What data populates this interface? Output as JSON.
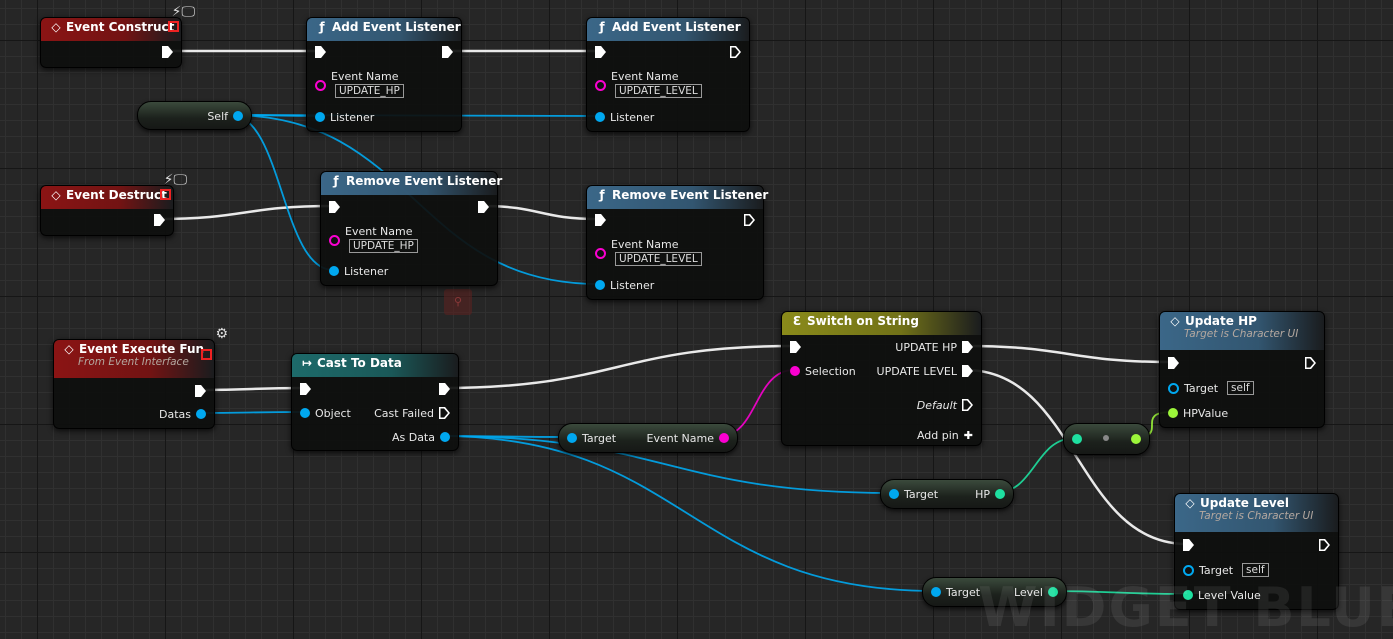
{
  "watermark": "WIDGET BLUEPRINT",
  "colors": {
    "exec": "#ffffff",
    "object": "#00a8f0",
    "string": "#fa00d0",
    "int": "#1ee0a0",
    "float": "#9cf63a",
    "event_header": "#8b1414",
    "function_header": "#3b6788",
    "cast_header": "#1d6a6a",
    "switch_header": "#8a8a1a"
  },
  "nodes": [
    {
      "id": "event-construct",
      "title": "Event Construct",
      "icon": "event-diamond-icon",
      "kind": "event",
      "badge": "monitor-icon",
      "pins": [
        {
          "dir": "out",
          "type": "exec"
        }
      ]
    },
    {
      "id": "add-listener-1",
      "title": "Add Event Listener",
      "icon": "function-icon",
      "kind": "function",
      "pins": [
        {
          "dir": "in",
          "type": "exec"
        },
        {
          "dir": "out",
          "type": "exec"
        },
        {
          "dir": "in",
          "type": "string",
          "label": "Event Name",
          "value": "UPDATE_HP"
        },
        {
          "dir": "in",
          "type": "object",
          "label": "Listener"
        }
      ]
    },
    {
      "id": "add-listener-2",
      "title": "Add Event Listener",
      "icon": "function-icon",
      "kind": "function",
      "pins": [
        {
          "dir": "in",
          "type": "exec"
        },
        {
          "dir": "out",
          "type": "exec-open"
        },
        {
          "dir": "in",
          "type": "string",
          "label": "Event Name",
          "value": "UPDATE_LEVEL"
        },
        {
          "dir": "in",
          "type": "object",
          "label": "Listener"
        }
      ]
    },
    {
      "id": "self",
      "title": "",
      "kind": "pill",
      "pins": [
        {
          "dir": "out",
          "type": "object",
          "label": "Self"
        }
      ]
    },
    {
      "id": "event-destruct",
      "title": "Event Destruct",
      "icon": "event-diamond-icon",
      "kind": "event",
      "badge": "monitor-icon",
      "pins": [
        {
          "dir": "out",
          "type": "exec"
        }
      ]
    },
    {
      "id": "remove-listener-1",
      "title": "Remove Event Listener",
      "icon": "function-icon",
      "kind": "function",
      "pins": [
        {
          "dir": "in",
          "type": "exec"
        },
        {
          "dir": "out",
          "type": "exec"
        },
        {
          "dir": "in",
          "type": "string",
          "label": "Event Name",
          "value": "UPDATE_HP"
        },
        {
          "dir": "in",
          "type": "object",
          "label": "Listener"
        }
      ]
    },
    {
      "id": "remove-listener-2",
      "title": "Remove Event Listener",
      "icon": "function-icon",
      "kind": "function",
      "pins": [
        {
          "dir": "in",
          "type": "exec"
        },
        {
          "dir": "out",
          "type": "exec-open"
        },
        {
          "dir": "in",
          "type": "string",
          "label": "Event Name",
          "value": "UPDATE_LEVEL"
        },
        {
          "dir": "in",
          "type": "object",
          "label": "Listener"
        }
      ]
    },
    {
      "id": "event-execute-fun",
      "title": "Event Execute Fun",
      "subtitle": "From Event Interface",
      "icon": "event-diamond-icon",
      "kind": "event",
      "badge": "interface-icon",
      "pins": [
        {
          "dir": "out",
          "type": "exec"
        },
        {
          "dir": "out",
          "type": "object",
          "label": "Datas"
        }
      ]
    },
    {
      "id": "cast-to-data",
      "title": "Cast To Data",
      "icon": "cast-icon",
      "kind": "cast",
      "pins": [
        {
          "dir": "in",
          "type": "exec"
        },
        {
          "dir": "out",
          "type": "exec"
        },
        {
          "dir": "in",
          "type": "object",
          "label": "Object"
        },
        {
          "dir": "out",
          "type": "exec-open",
          "label": "Cast Failed"
        },
        {
          "dir": "out",
          "type": "object",
          "label": "As Data"
        }
      ]
    },
    {
      "id": "get-event-name",
      "title": "",
      "kind": "pill",
      "pins": [
        {
          "dir": "in",
          "type": "object",
          "label": "Target"
        },
        {
          "dir": "out",
          "type": "string",
          "label": "Event Name"
        }
      ]
    },
    {
      "id": "switch-on-string",
      "title": "Switch on String",
      "icon": "switch-icon",
      "kind": "switch",
      "pins": [
        {
          "dir": "in",
          "type": "exec"
        },
        {
          "dir": "out",
          "type": "exec",
          "label": "UPDATE HP"
        },
        {
          "dir": "in",
          "type": "string",
          "label": "Selection"
        },
        {
          "dir": "out",
          "type": "exec",
          "label": "UPDATE LEVEL"
        },
        {
          "dir": "out",
          "type": "exec-open",
          "label": "Default"
        },
        {
          "dir": "out",
          "type": "add",
          "label": "Add pin"
        }
      ]
    },
    {
      "id": "update-hp",
      "title": "Update HP",
      "subtitle": "Target is Character UI",
      "icon": "event-diamond-icon",
      "kind": "function",
      "pins": [
        {
          "dir": "in",
          "type": "exec"
        },
        {
          "dir": "out",
          "type": "exec-open"
        },
        {
          "dir": "in",
          "type": "object-ring",
          "label": "Target",
          "value": "self"
        },
        {
          "dir": "in",
          "type": "float",
          "label": "HPValue"
        }
      ]
    },
    {
      "id": "convert",
      "title": "",
      "kind": "pill",
      "pins": [
        {
          "dir": "in",
          "type": "int"
        },
        {
          "dir": "out",
          "type": "float"
        }
      ]
    },
    {
      "id": "get-hp",
      "title": "",
      "kind": "pill",
      "pins": [
        {
          "dir": "in",
          "type": "object",
          "label": "Target"
        },
        {
          "dir": "out",
          "type": "int",
          "label": "HP"
        }
      ]
    },
    {
      "id": "update-level",
      "title": "Update Level",
      "subtitle": "Target is Character UI",
      "icon": "event-diamond-icon",
      "kind": "function",
      "pins": [
        {
          "dir": "in",
          "type": "exec"
        },
        {
          "dir": "out",
          "type": "exec-open"
        },
        {
          "dir": "in",
          "type": "object-ring",
          "label": "Target",
          "value": "self"
        },
        {
          "dir": "in",
          "type": "int",
          "label": "Level Value"
        }
      ]
    },
    {
      "id": "get-level",
      "title": "",
      "kind": "pill",
      "pins": [
        {
          "dir": "in",
          "type": "object",
          "label": "Target"
        },
        {
          "dir": "out",
          "type": "int",
          "label": "Level"
        }
      ]
    }
  ]
}
